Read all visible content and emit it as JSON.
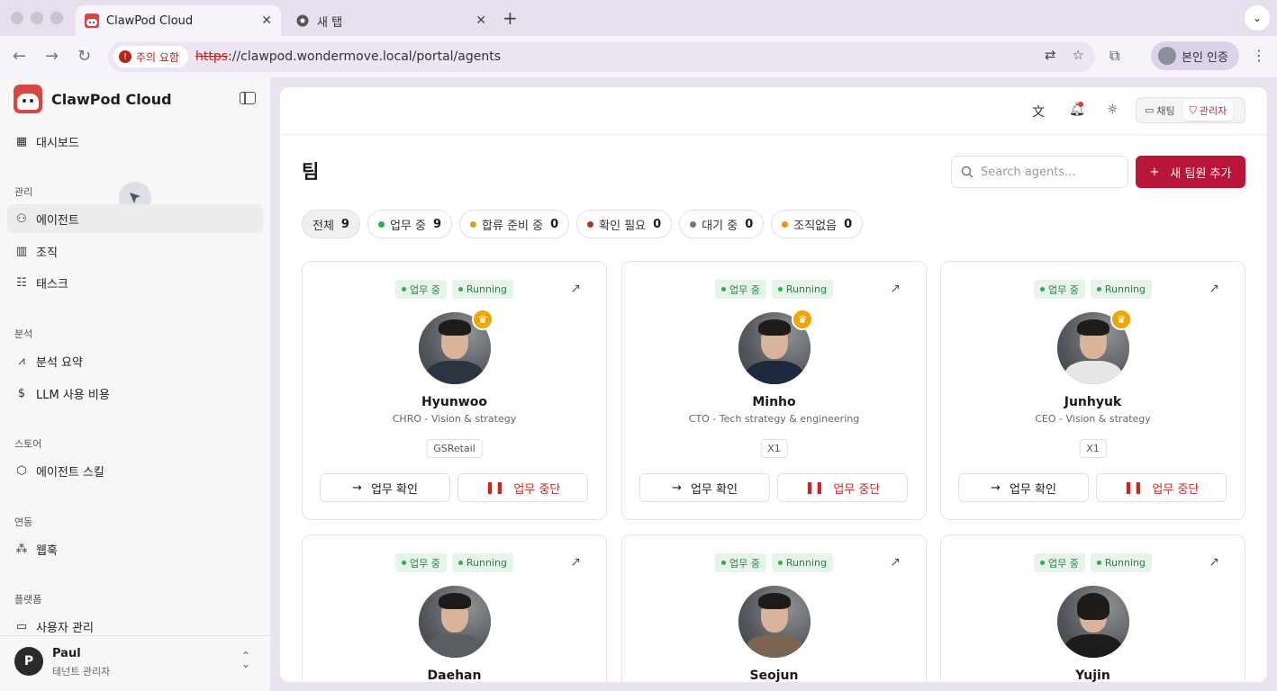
{
  "browser": {
    "tabs": [
      {
        "title": "ClawPod Cloud",
        "active": true
      },
      {
        "title": "새 탭",
        "active": false
      }
    ],
    "security_chip": "주의 요함",
    "url_scheme": "https",
    "url_rest": "://clawpod.wondermove.local/portal/agents",
    "profile_label": "본인 인증"
  },
  "sidebar": {
    "brand": "ClawPod Cloud",
    "dashboard": "대시보드",
    "sections": {
      "manage": "관리",
      "analytics": "분석",
      "store": "스토어",
      "integration": "연동",
      "platform": "플랫폼"
    },
    "items": {
      "agents": "에이전트",
      "org": "조직",
      "tasks": "태스크",
      "analysis_summary": "분석 요약",
      "llm_cost": "LLM 사용 비용",
      "agent_skills": "에이전트 스킬",
      "webhook": "웹훅",
      "user_management": "사용자 관리"
    },
    "user": {
      "initial": "P",
      "name": "Paul",
      "role": "테넌트 관리자"
    }
  },
  "topbar": {
    "chat_label": "채팅",
    "admin_label": "관리자"
  },
  "main": {
    "title": "팀",
    "search_placeholder": "Search agents...",
    "add_button": "새 팀원 추가",
    "filters": [
      {
        "label": "전체",
        "count": "9",
        "color": ""
      },
      {
        "label": "업무 중",
        "count": "9",
        "color": "#34a853"
      },
      {
        "label": "합류 준비 중",
        "count": "0",
        "color": "#c9a227"
      },
      {
        "label": "확인 필요",
        "count": "0",
        "color": "#a33a1f"
      },
      {
        "label": "대기 중",
        "count": "0",
        "color": "#6b7d6b"
      },
      {
        "label": "조직없음",
        "count": "0",
        "color": "#f08a24"
      }
    ]
  },
  "cards": [
    {
      "status": "업무 중",
      "state": "Running",
      "name": "Hyunwoo",
      "role": "CHRO - Vision & strategy",
      "tag": "GSRetail",
      "check": "업무 확인",
      "stop": "업무 중단"
    },
    {
      "status": "업무 중",
      "state": "Running",
      "name": "Minho",
      "role": "CTO - Tech strategy & engineering",
      "tag": "X1",
      "check": "업무 확인",
      "stop": "업무 중단"
    },
    {
      "status": "업무 중",
      "state": "Running",
      "name": "Junhyuk",
      "role": "CEO - Vision & strategy",
      "tag": "X1",
      "check": "업무 확인",
      "stop": "업무 중단"
    },
    {
      "status": "업무 중",
      "state": "Running",
      "name": "Daehan"
    },
    {
      "status": "업무 중",
      "state": "Running",
      "name": "Seojun"
    },
    {
      "status": "업무 중",
      "state": "Running",
      "name": "Yujin"
    }
  ]
}
